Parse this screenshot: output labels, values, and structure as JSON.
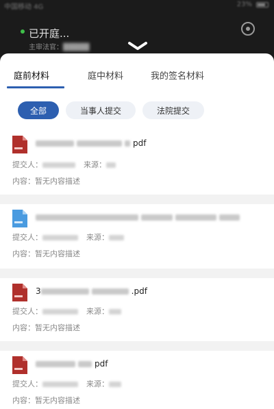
{
  "status_bar": {
    "left_text": "中国移动 4G",
    "right_text": "23%"
  },
  "header": {
    "status_text": "已开庭...",
    "judge_label": "主审法官："
  },
  "tabs": [
    {
      "label": "庭前材料",
      "active": true
    },
    {
      "label": "庭中材料",
      "active": false
    },
    {
      "label": "我的签名材料",
      "active": false
    }
  ],
  "filters": [
    {
      "label": "全部",
      "active": true
    },
    {
      "label": "当事人提交",
      "active": false
    },
    {
      "label": "法院提交",
      "active": false
    }
  ],
  "documents": [
    {
      "type": "pdf",
      "name_suffix": "pdf",
      "submitter_label": "提交人：",
      "source_label": "来源：",
      "content": "内容：暂无内容描述"
    },
    {
      "type": "doc",
      "name_suffix": "",
      "submitter_label": "提交人：",
      "source_label": "来源：",
      "content": "内容：暂无内容描述"
    },
    {
      "type": "pdf",
      "name_prefix": "3",
      "name_suffix": ".pdf",
      "submitter_label": "提交人：",
      "source_label": "来源：",
      "content": "内容：暂无内容描述"
    },
    {
      "type": "pdf",
      "name_suffix": "pdf",
      "submitter_label": "提交人：",
      "source_label": "来源：",
      "content": "内容：暂无内容描述"
    }
  ],
  "colors": {
    "accent": "#2d5fb0",
    "pdf_icon": "#b0302c",
    "doc_icon": "#4a9be0",
    "online_dot": "#3fbf4a"
  }
}
